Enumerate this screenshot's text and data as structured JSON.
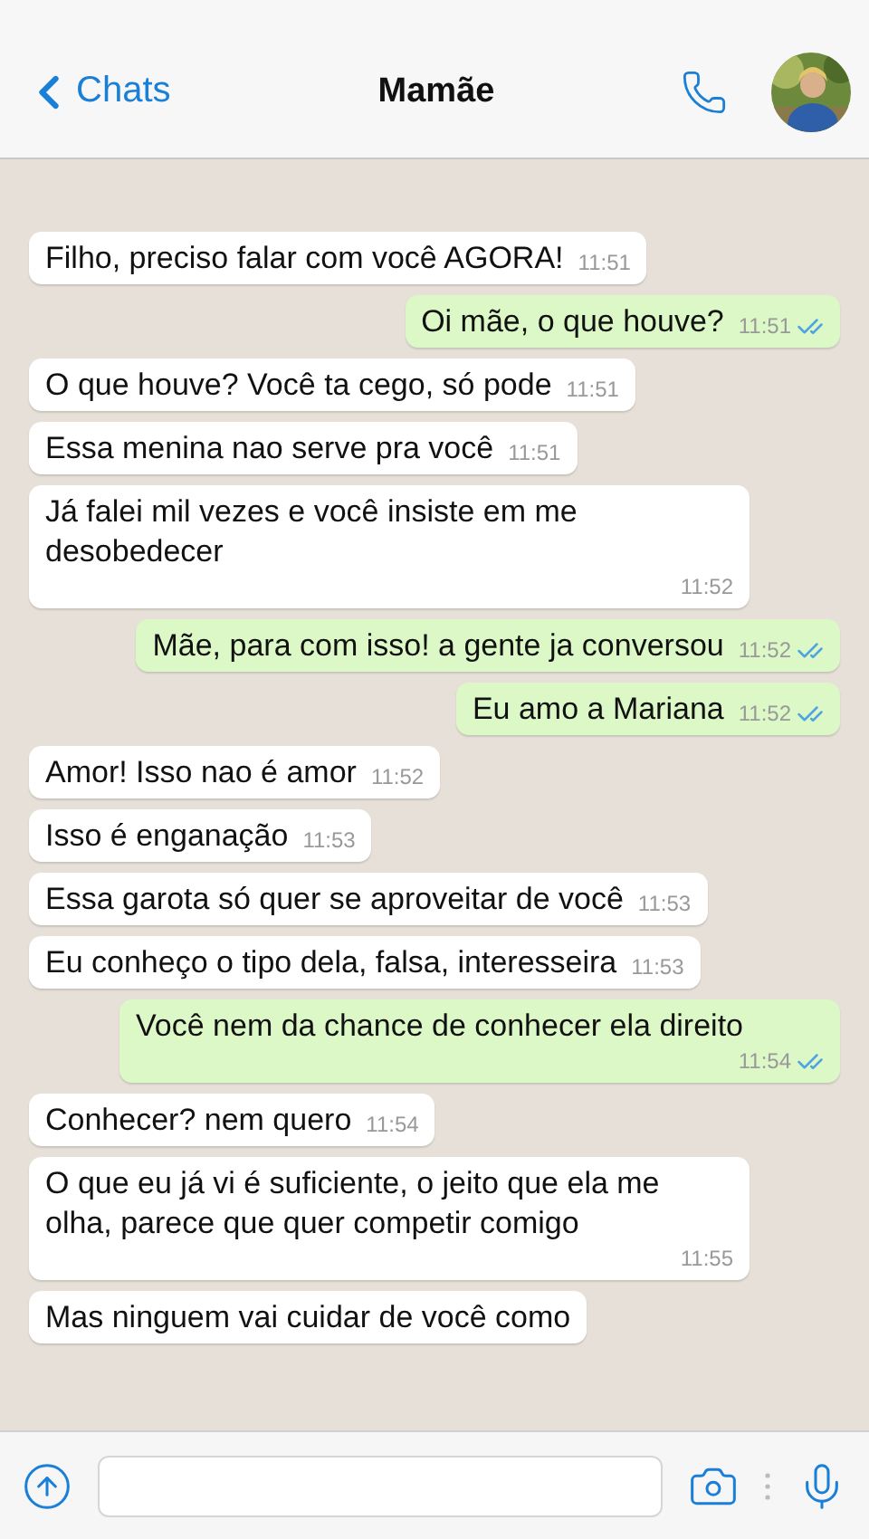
{
  "header": {
    "back_label": "Chats",
    "title": "Mamãe"
  },
  "messages": [
    {
      "kind": "received",
      "text": "Filho, preciso falar com você AGORA!",
      "time": "11:51"
    },
    {
      "kind": "sent",
      "text": "Oi mãe, o que houve?",
      "time": "11:51",
      "read": true
    },
    {
      "kind": "received",
      "text": "O que houve? Você ta cego, só pode",
      "time": "11:51"
    },
    {
      "kind": "received",
      "text": "Essa menina nao serve pra você",
      "time": "11:51"
    },
    {
      "kind": "received",
      "text": "Já falei mil vezes e você insiste em me desobedecer",
      "time": "11:52"
    },
    {
      "kind": "sent",
      "text": "Mãe, para com isso! a gente ja conversou",
      "time": "11:52",
      "read": true
    },
    {
      "kind": "sent",
      "text": "Eu amo a Mariana",
      "time": "11:52",
      "read": true
    },
    {
      "kind": "received",
      "text": "Amor! Isso nao é amor",
      "time": "11:52"
    },
    {
      "kind": "received",
      "text": "Isso é enganação",
      "time": "11:53"
    },
    {
      "kind": "received",
      "text": "Essa garota só quer se aproveitar de você",
      "time": "11:53"
    },
    {
      "kind": "received",
      "text": "Eu conheço o tipo dela, falsa, interesseira",
      "time": "11:53"
    },
    {
      "kind": "sent",
      "text": "Você nem da chance de conhecer ela direito",
      "time": "11:54",
      "read": true
    },
    {
      "kind": "received",
      "text": "Conhecer? nem quero",
      "time": "11:54"
    },
    {
      "kind": "received",
      "text": "O que eu já vi é suficiente, o jeito que ela me olha, parece que quer competir comigo",
      "time": "11:55"
    },
    {
      "kind": "received",
      "text": "Mas ninguem vai cuidar de você como"
    }
  ]
}
